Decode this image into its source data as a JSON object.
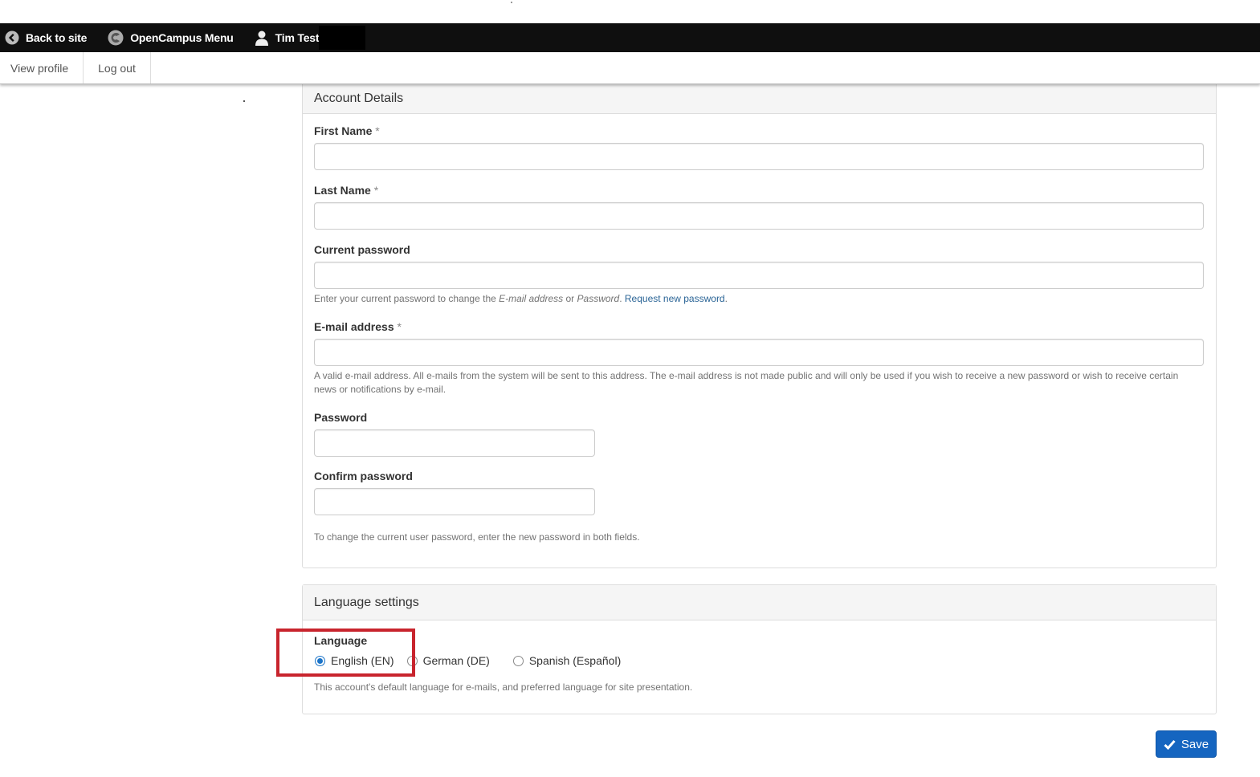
{
  "toolbar": {
    "back_label": "Back to site",
    "menu_label": "OpenCampus Menu",
    "user_label": "Tim Test"
  },
  "tray": {
    "view_profile": "View profile",
    "log_out": "Log out"
  },
  "account_details": {
    "title": "Account Details",
    "first_name": {
      "label": "First Name",
      "required_mark": "*",
      "value": ""
    },
    "last_name": {
      "label": "Last Name",
      "required_mark": "*",
      "value": ""
    },
    "current_password": {
      "label": "Current password",
      "value": "",
      "help_prefix": "Enter your current password to change the ",
      "help_em1": "E-mail address",
      "help_mid": " or ",
      "help_em2": "Password",
      "help_suffix": ". ",
      "help_link": "Request new password",
      "help_end": "."
    },
    "email": {
      "label": "E-mail address",
      "required_mark": "*",
      "value": "",
      "help_line1": "A valid e-mail address. All e-mails from the system will be sent to this address. The e-mail address is not made public and will only be used if you wish to receive a new password or wish to receive certain",
      "help_line2": "news or notifications by e-mail."
    },
    "password": {
      "label": "Password",
      "value": ""
    },
    "confirm_password": {
      "label": "Confirm password",
      "value": ""
    },
    "password_help": "To change the current user password, enter the new password in both fields."
  },
  "language_settings": {
    "title": "Language settings",
    "label": "Language",
    "options": [
      {
        "label": "English (EN)",
        "selected": true
      },
      {
        "label": "German (DE)",
        "selected": false
      },
      {
        "label": "Spanish (Español)",
        "selected": false
      }
    ],
    "help": "This account's default language for e-mails, and preferred language for site presentation."
  },
  "actions": {
    "save_label": "Save",
    "save_color": "#1565c0"
  },
  "annotation": {
    "highlight_color": "#c8242d"
  }
}
